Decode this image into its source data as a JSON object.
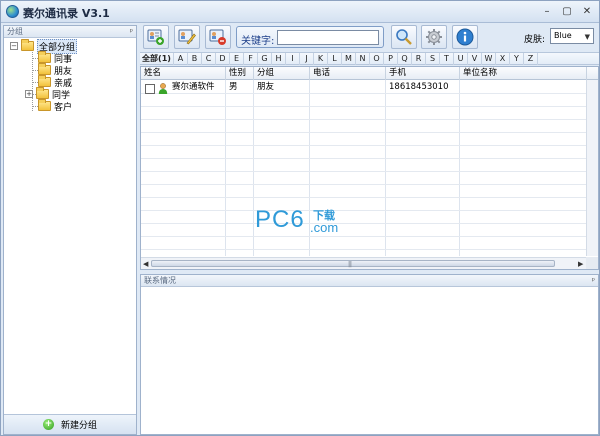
{
  "window": {
    "title": "赛尔通讯录 V3.1",
    "controls": [
      "–",
      "▢",
      "✕"
    ]
  },
  "left_panel": {
    "header": "分组",
    "pin": "ᵖ",
    "tree": {
      "root": "全部分组",
      "children": [
        "同事",
        "朋友",
        "亲戚",
        "同学",
        "客户"
      ]
    },
    "new_group_label": "新建分组"
  },
  "toolbar": {
    "search_label": "关键字:",
    "search_value": "",
    "skin_label": "皮肤:",
    "skin_value": "Blue"
  },
  "letter_bar": {
    "all_label": "全部(1)",
    "letters": [
      "A",
      "B",
      "C",
      "D",
      "E",
      "F",
      "G",
      "H",
      "I",
      "J",
      "K",
      "L",
      "M",
      "N",
      "O",
      "P",
      "Q",
      "R",
      "S",
      "T",
      "U",
      "V",
      "W",
      "X",
      "Y",
      "Z"
    ]
  },
  "grid": {
    "columns": [
      "姓名",
      "性别",
      "分组",
      "电话",
      "手机",
      "单位名称"
    ],
    "rows": [
      {
        "name": "赛尔通软件",
        "gender": "男",
        "group": "朋友",
        "phone": "",
        "mobile": "18618453010",
        "company": ""
      }
    ]
  },
  "contact_panel": {
    "header": "联系情况"
  },
  "watermark": {
    "pc": "PC6",
    "cn": "下载",
    "com": ".com"
  },
  "colors": {
    "accent": "#2f9ad8",
    "chrome": "#dfe9f5"
  }
}
